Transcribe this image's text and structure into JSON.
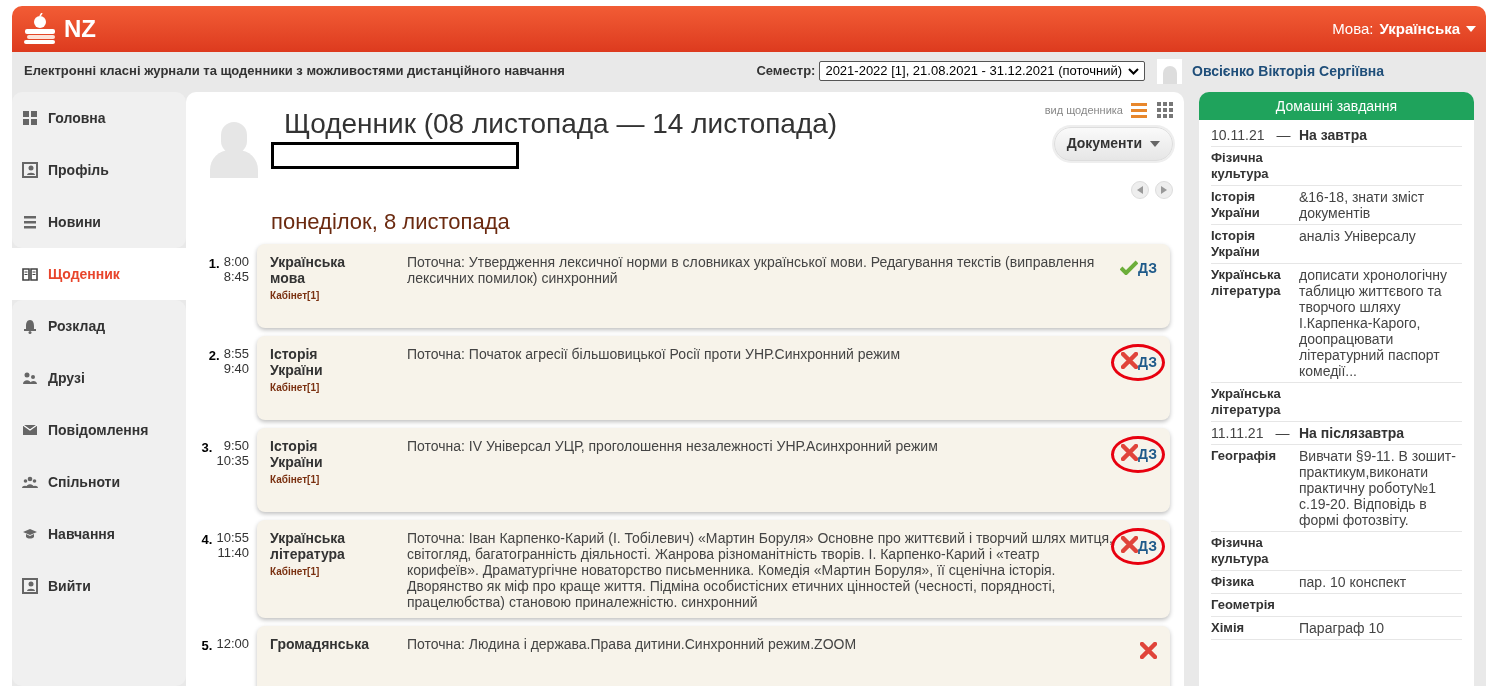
{
  "header": {
    "logo_text": "NZ",
    "language_label": "Мова:",
    "language_value": "Українська"
  },
  "subheader": {
    "tagline": "Електронні класні журнали та щоденники з можливостями дистанційного навчання",
    "semester_label": "Семестр:",
    "semester_value": "2021-2022 [1], 21.08.2021 - 31.12.2021 (поточний)",
    "user_name": "Овсієнко Вікторія Сергіївна"
  },
  "sidebar": {
    "items": [
      {
        "label": "Головна",
        "selected": false
      },
      {
        "label": "Профіль",
        "selected": false
      },
      {
        "label": "Новини",
        "selected": false
      },
      {
        "label": "Щоденник",
        "selected": true
      },
      {
        "label": "Розклад",
        "selected": false
      },
      {
        "label": "Друзі",
        "selected": false
      },
      {
        "label": "Повідомлення",
        "selected": false
      },
      {
        "label": "Спільноти",
        "selected": false
      },
      {
        "label": "Навчання",
        "selected": false
      },
      {
        "label": "Вийти",
        "selected": false
      }
    ]
  },
  "diary": {
    "title": "Щоденник (08 листопада — 14 листопада)",
    "name_redacted": true,
    "view_label": "вид щоденника",
    "views": [
      {
        "kind": "list",
        "selected": true
      },
      {
        "kind": "grid",
        "selected": false
      }
    ],
    "documents_button": "Документи",
    "day": "понеділок, 8 листопада",
    "lessons": [
      {
        "number": "1.",
        "start": "8:00",
        "end": "8:45",
        "subject": "Українська мова",
        "room": "Кабінет[1]",
        "topic": "Поточна: Утвердження лексичної норми в словниках української мови. Редагування текстів (виправлення лексичних помилок) синхронний",
        "homework_done": true,
        "homework_label": "ДЗ",
        "circled": false
      },
      {
        "number": "2.",
        "start": "8:55",
        "end": "9:40",
        "subject": "Історія України",
        "room": "Кабінет[1]",
        "topic": "Поточна: Початок агресії більшовицької Росії проти УНР.Синхронний режим",
        "homework_done": false,
        "homework_label": "ДЗ",
        "circled": true
      },
      {
        "number": "3.",
        "start": "9:50",
        "end": "10:35",
        "subject": "Історія України",
        "room": "Кабінет[1]",
        "topic": "Поточна: IV Універсал УЦР, проголошення незалежності УНР.Асинхронний режим",
        "homework_done": false,
        "homework_label": "ДЗ",
        "circled": true
      },
      {
        "number": "4.",
        "start": "10:55",
        "end": "11:40",
        "subject": "Українська література",
        "room": "Кабінет[1]",
        "topic": "Поточна: Іван Карпенко-Карий (І. Тобілевич) «Мартин Боруля» Основне про життєвий і творчий шлях митця, світогляд, багатогранність діяльності. Жанрова різноманітність творів. І. Карпенко-Карий і «театр корифеїв». Драматургічне новаторство письменника. Комедія «Мартин Боруля», її сценічна історія. Дворянство як міф про краще життя. Підміна особистісних етичних цінностей (чесності, порядності, працелюбства) становою приналежністю. синхронний",
        "homework_done": false,
        "homework_label": "ДЗ",
        "circled": true
      },
      {
        "number": "5.",
        "start": "12:00",
        "subject": "Громадянська",
        "topic": "Поточна: Людина і держава.Права дитини.Синхронний режим.ZOOM",
        "homework_done": false,
        "circled": false
      }
    ]
  },
  "homework": {
    "title": "Домашні завдання",
    "rows": [
      {
        "kind": "date",
        "date": "10.11.21",
        "dash": "—",
        "label": "На завтра"
      },
      {
        "kind": "subject",
        "subject": "Фізична культура"
      },
      {
        "kind": "subject",
        "subject": "Історія України",
        "task": "&16-18, знати зміст документів"
      },
      {
        "kind": "subject",
        "subject": "Історія України",
        "task": "аналіз Універсалу"
      },
      {
        "kind": "subject",
        "subject": "Українська література",
        "task": "дописати хронологічну таблицю життєвого та творчого шляху І.Карпенка-Карого, доопрацювати літературний паспорт комедії..."
      },
      {
        "kind": "subject",
        "subject": "Українська література"
      },
      {
        "kind": "date",
        "date": "11.11.21",
        "dash": "—",
        "label": "На післязавтра"
      },
      {
        "kind": "subject",
        "subject": "Географія",
        "task": "Вивчати §9-11. В зошит-практикум,виконати практичну роботу№1 с.19-20. Відповідь в формі фотозвіту."
      },
      {
        "kind": "subject",
        "subject": "Фізична культура"
      },
      {
        "kind": "subject",
        "subject": "Фізика",
        "task": "пар. 10 конспект"
      },
      {
        "kind": "subject",
        "subject": "Геометрія"
      },
      {
        "kind": "subject",
        "subject": "Хімія",
        "task": "Параграф 10"
      }
    ]
  }
}
